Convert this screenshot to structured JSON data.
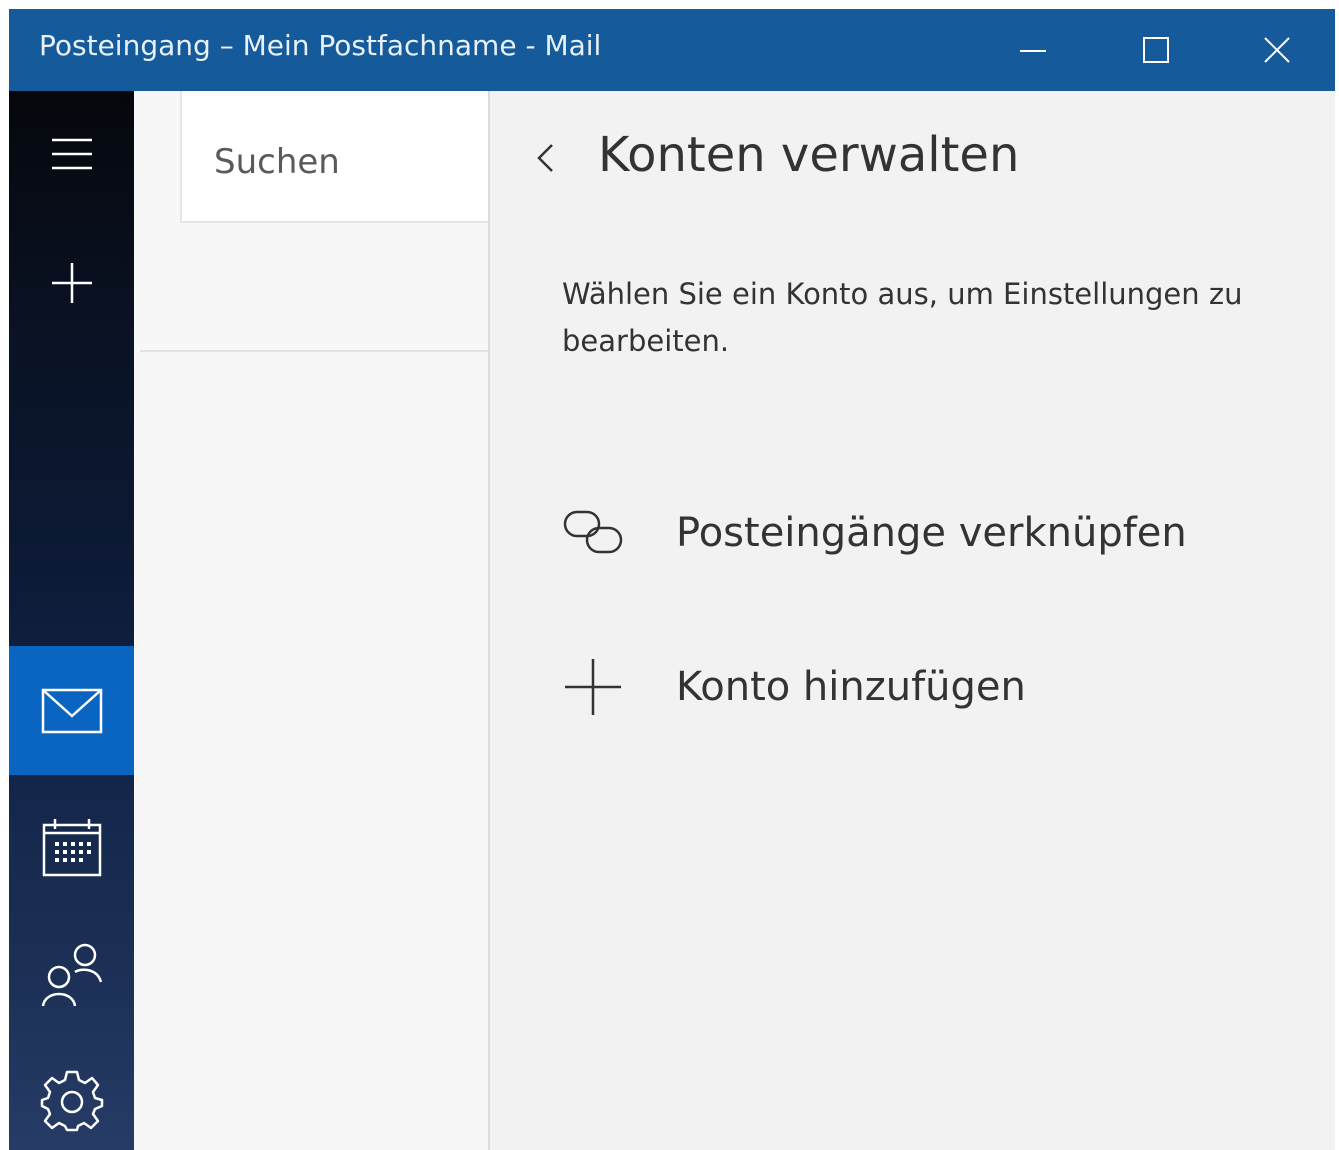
{
  "window": {
    "title": "Posteingang – Mein Postfachname - Mail"
  },
  "search": {
    "placeholder": "Suchen"
  },
  "settings_panel": {
    "title": "Konten verwalten",
    "description": "Wählen Sie ein Konto aus, um Einstellungen zu bearbeiten.",
    "actions": [
      {
        "label": "Posteingänge verknüpfen",
        "icon": "link-icon"
      },
      {
        "label": "Konto hinzufügen",
        "icon": "plus-icon"
      }
    ]
  },
  "rail": {
    "items": [
      {
        "icon": "hamburger-menu-icon"
      },
      {
        "icon": "new-mail-plus-icon"
      },
      {
        "icon": "mail-icon",
        "active": true
      },
      {
        "icon": "calendar-icon"
      },
      {
        "icon": "people-icon"
      },
      {
        "icon": "gear-icon"
      }
    ]
  },
  "colors": {
    "titlebar": "#155a9b",
    "accent": "#0a64c2",
    "panel_bg": "#f2f2f2"
  }
}
